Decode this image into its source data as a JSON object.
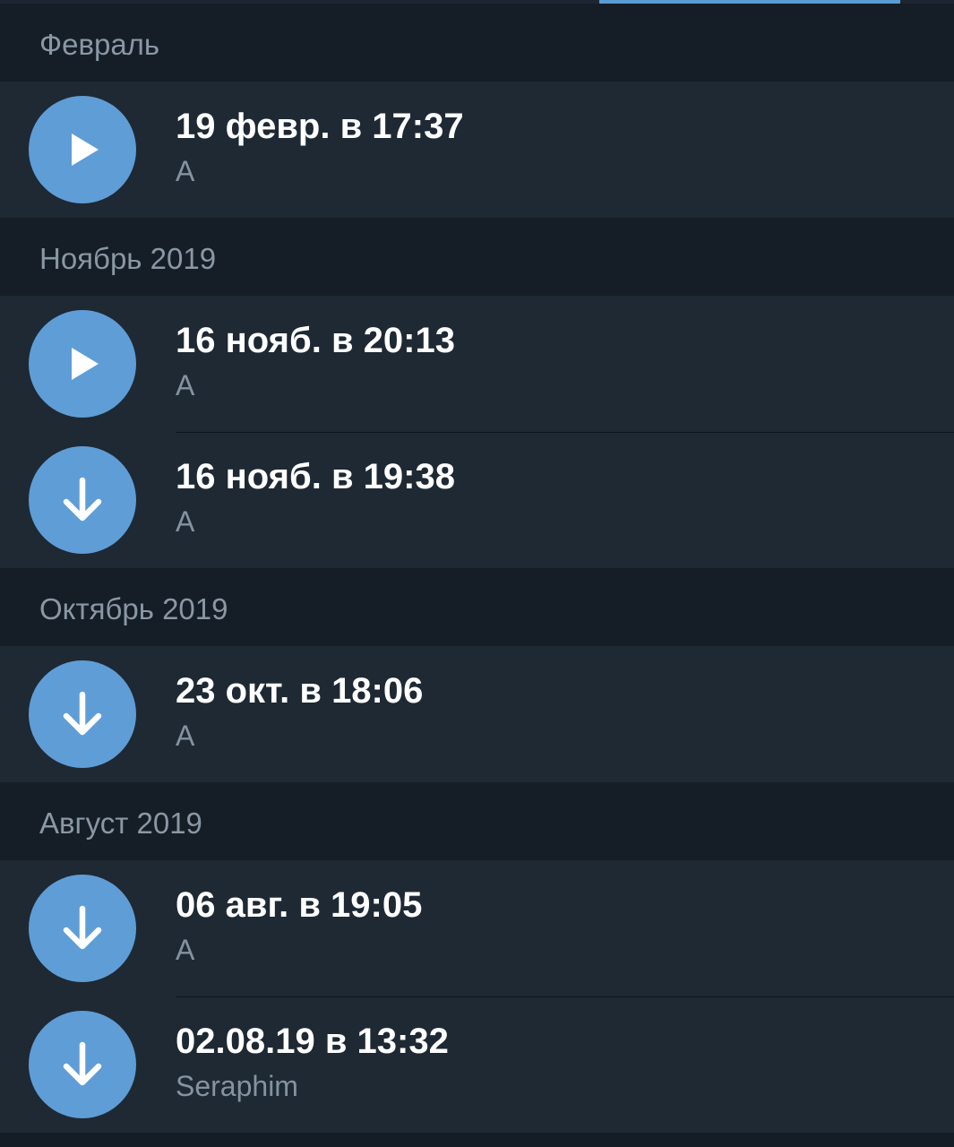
{
  "sections": [
    {
      "header": "Февраль",
      "items": [
        {
          "title": "19 февр. в 17:37",
          "subtitle": "A",
          "action_icon": "play-icon"
        }
      ]
    },
    {
      "header": "Ноябрь 2019",
      "items": [
        {
          "title": "16 нояб. в 20:13",
          "subtitle": "A",
          "action_icon": "play-icon"
        },
        {
          "title": "16 нояб. в 19:38",
          "subtitle": "A",
          "action_icon": "download-arrow-icon"
        }
      ]
    },
    {
      "header": "Октябрь 2019",
      "items": [
        {
          "title": "23 окт. в 18:06",
          "subtitle": "A",
          "action_icon": "download-arrow-icon"
        }
      ]
    },
    {
      "header": "Август 2019",
      "items": [
        {
          "title": "06 авг. в 19:05",
          "subtitle": "A",
          "action_icon": "download-arrow-icon"
        },
        {
          "title": "02.08.19 в 13:32",
          "subtitle": "Seraphim",
          "action_icon": "download-arrow-icon"
        }
      ]
    }
  ],
  "colors": {
    "accent": "#5f9dd6",
    "tab_indicator": "#5b9bd5",
    "header_bg": "#151d26",
    "item_bg": "#1e2934",
    "title_text": "#ffffff",
    "subtitle_text": "#8592a0",
    "header_text": "#8a97a4"
  }
}
